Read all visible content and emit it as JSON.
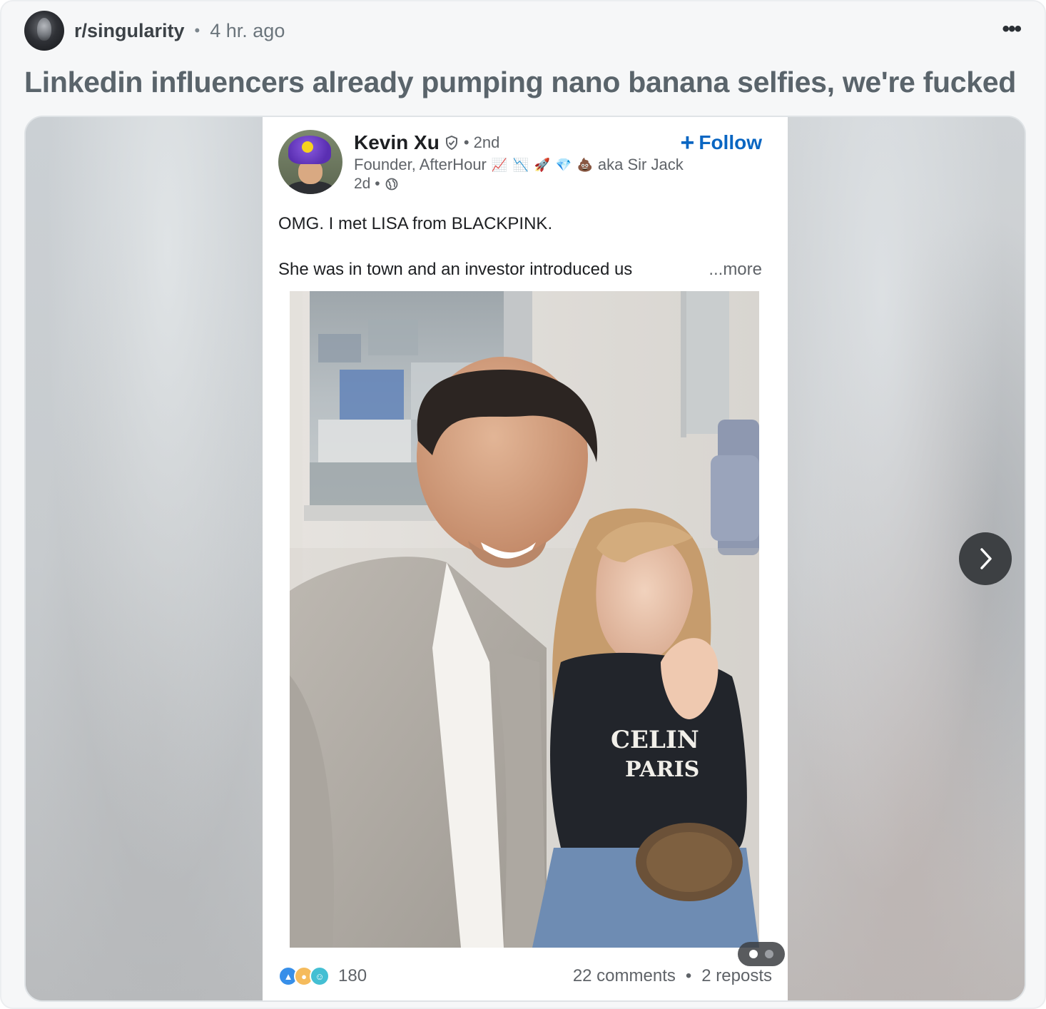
{
  "post": {
    "subreddit": "r/singularity",
    "separator": "•",
    "time_ago": "4 hr. ago",
    "more_label": "•••",
    "title": "Linkedin influencers already pumping nano banana selfies, we're fucked"
  },
  "linkedin": {
    "author_name": "Kevin Xu",
    "degree": "• 2nd",
    "headline_prefix": "Founder, AfterHour",
    "headline_emojis": [
      "📈",
      "📉",
      "🚀",
      "💎",
      "💩"
    ],
    "headline_suffix": "aka Sir Jack",
    "posted": "2d •",
    "follow_plus": "+",
    "follow_label": "Follow",
    "text_line1": "OMG. I met LISA from BLACKPINK.",
    "text_line2": "She was in town and an investor introduced us",
    "more_label": "...more",
    "shirt_text_line1": "CELIN",
    "shirt_text_line2": "PARIS",
    "reaction_count": "180",
    "comments": "22 comments",
    "engagement_separator": "•",
    "reposts": "2 reposts",
    "reaction_colors": [
      "#378fe9",
      "#f5bb5c",
      "#44bfd3"
    ]
  },
  "carousel": {
    "total_slides": 2,
    "active_slide": 1
  }
}
